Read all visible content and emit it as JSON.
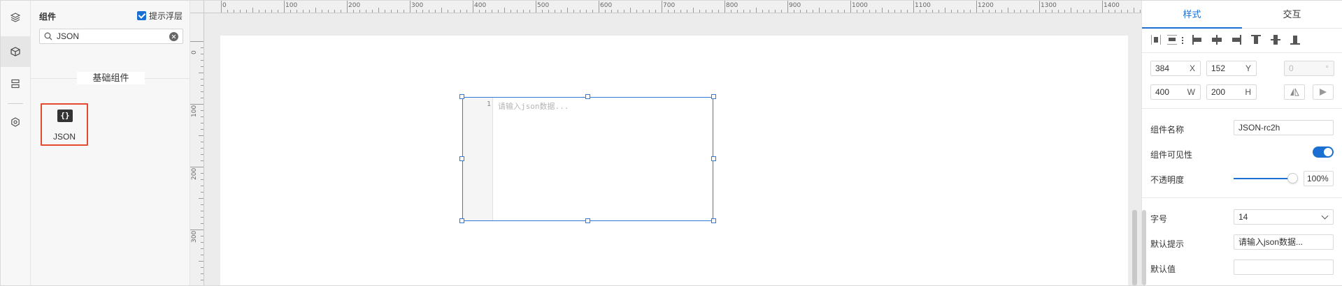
{
  "rail": {
    "items": [
      {
        "icon": "layers-icon"
      },
      {
        "icon": "cube-icon"
      },
      {
        "icon": "template-icon"
      },
      {
        "icon": "settings-icon"
      }
    ]
  },
  "components_panel": {
    "title": "组件",
    "overlay_hint_label": "提示浮层",
    "overlay_hint_checked": true,
    "search_value": "JSON",
    "section_label": "基础组件",
    "items": [
      {
        "label": "JSON",
        "glyph": "{}"
      }
    ]
  },
  "canvas": {
    "ruler_top_labels": [
      "0",
      "100",
      "200",
      "300",
      "400",
      "500",
      "600",
      "700",
      "800",
      "900",
      "1000",
      "1100",
      "1200",
      "1300",
      "1400"
    ],
    "ruler_left_labels": [
      "0",
      "100",
      "200",
      "300"
    ],
    "json_editor": {
      "line_number": "1",
      "placeholder": "请输入json数据..."
    }
  },
  "props": {
    "tabs": [
      {
        "label": "样式",
        "active": true
      },
      {
        "label": "交互",
        "active": false
      }
    ],
    "x": "384",
    "x_label": "X",
    "y": "152",
    "y_label": "Y",
    "rotation": "0",
    "rotation_unit": "°",
    "w": "400",
    "w_label": "W",
    "h": "200",
    "h_label": "H",
    "name_label": "组件名称",
    "name_value": "JSON-rc2h",
    "visible_label": "组件可见性",
    "visible": true,
    "opacity_label": "不透明度",
    "opacity_value": "100%",
    "font_size_label": "字号",
    "font_size_value": "14",
    "placeholder_label": "默认提示",
    "placeholder_value": "请输入json数据...",
    "default_value_label": "默认值",
    "default_value": ""
  },
  "colors": {
    "accent": "#1b6fd2",
    "tile_highlight": "#e64a2e"
  }
}
